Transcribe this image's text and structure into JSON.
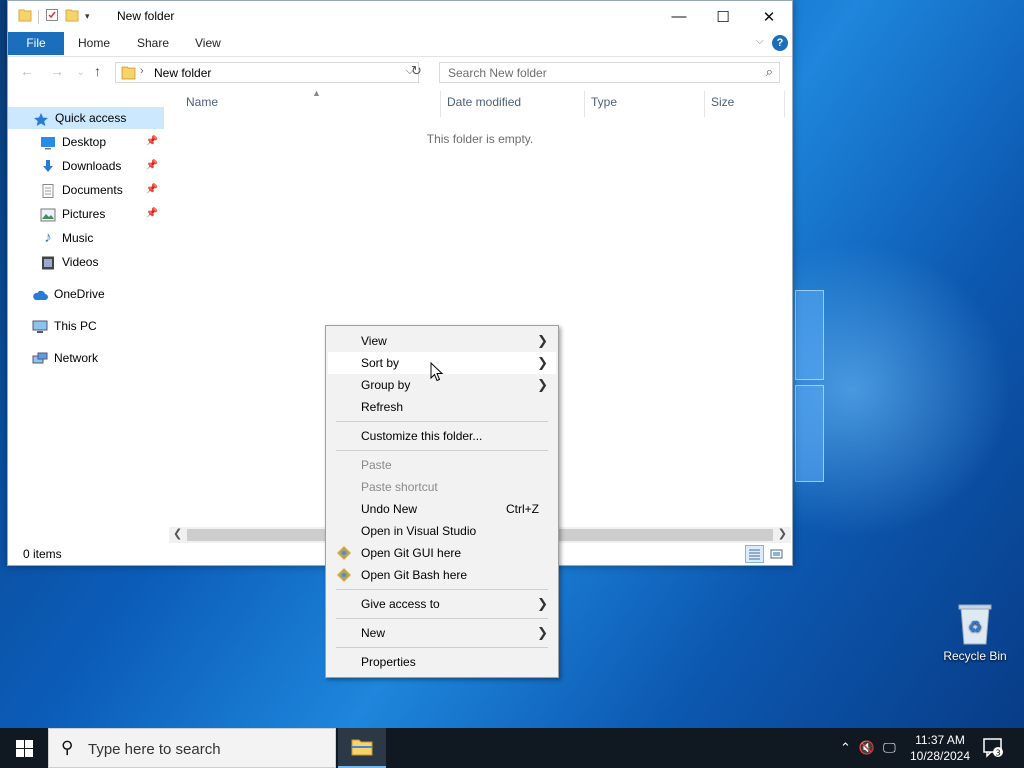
{
  "window": {
    "title": "New folder",
    "controls": {
      "minimize": "—",
      "maximize": "☐",
      "close": "✕"
    },
    "ribbon_tabs": {
      "file": "File",
      "home": "Home",
      "share": "Share",
      "view": "View"
    },
    "help": "?",
    "address": {
      "path": "New folder"
    },
    "search": {
      "placeholder": "Search New folder"
    },
    "columns": {
      "name": "Name",
      "date_modified": "Date modified",
      "type": "Type",
      "size": "Size"
    },
    "empty_text": "This folder is empty.",
    "status_text": "0 items"
  },
  "sidebar": {
    "items": [
      {
        "label": "Quick access",
        "icon": "star-icon"
      },
      {
        "label": "Desktop",
        "icon": "desktop-icon",
        "pinned": true
      },
      {
        "label": "Downloads",
        "icon": "download-icon",
        "pinned": true
      },
      {
        "label": "Documents",
        "icon": "document-icon",
        "pinned": true
      },
      {
        "label": "Pictures",
        "icon": "pictures-icon",
        "pinned": true
      },
      {
        "label": "Music",
        "icon": "music-icon"
      },
      {
        "label": "Videos",
        "icon": "video-icon"
      },
      {
        "label": "OneDrive",
        "icon": "cloud-icon"
      },
      {
        "label": "This PC",
        "icon": "computer-icon"
      },
      {
        "label": "Network",
        "icon": "network-icon"
      }
    ]
  },
  "context_menu": {
    "view": "View",
    "sort_by": "Sort by",
    "group_by": "Group by",
    "refresh": "Refresh",
    "customize": "Customize this folder...",
    "paste": "Paste",
    "paste_shortcut": "Paste shortcut",
    "undo_new": "Undo New",
    "undo_shortcut": "Ctrl+Z",
    "open_vs": "Open in Visual Studio",
    "git_gui": "Open Git GUI here",
    "git_bash": "Open Git Bash here",
    "give_access": "Give access to",
    "new": "New",
    "properties": "Properties"
  },
  "desktop": {
    "recycle_bin": "Recycle Bin"
  },
  "taskbar": {
    "search_placeholder": "Type here to search",
    "time": "11:37 AM",
    "date": "10/28/2024",
    "notifications": "3"
  },
  "colors": {
    "accent": "#1a6ebc",
    "selection": "#cce8ff",
    "taskbar": "#101822"
  }
}
